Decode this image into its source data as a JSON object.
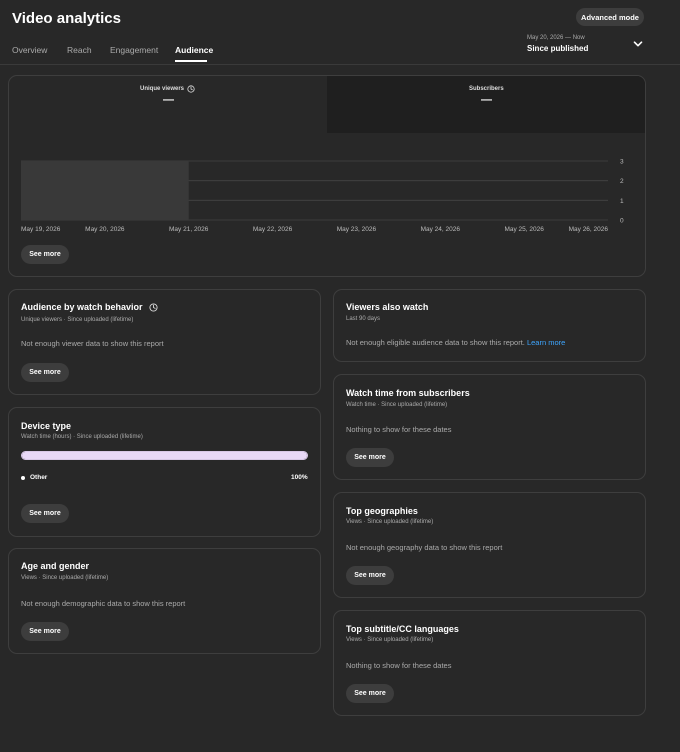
{
  "header": {
    "title": "Video analytics",
    "advanced_mode": "Advanced mode",
    "tabs": [
      "Overview",
      "Reach",
      "Engagement",
      "Audience"
    ],
    "active_tab": "Audience",
    "date_range": "May 20, 2026 — Now",
    "date_label": "Since published"
  },
  "metrics": {
    "unique_viewers_label": "Unique viewers",
    "unique_viewers_value": "—",
    "subscribers_label": "Subscribers",
    "subscribers_value": "—"
  },
  "chart_data": {
    "type": "line",
    "x": [
      "May 19, 2026",
      "May 20, 2026",
      "May 21, 2026",
      "May 22, 2026",
      "May 23, 2026",
      "May 24, 2026",
      "May 25, 2026",
      "May 26, 2026"
    ],
    "series": [],
    "ylim": [
      0,
      3
    ],
    "yticks": [
      "0",
      "1",
      "2",
      "3"
    ],
    "highlight_range": [
      "May 19, 2026",
      "May 21, 2026"
    ],
    "grid": true
  },
  "main_see_more": "See more",
  "cards": {
    "watch_behavior": {
      "title": "Audience by watch behavior",
      "subtitle": "Unique viewers · Since uploaded (lifetime)",
      "message": "Not enough viewer data to show this report",
      "button": "See more"
    },
    "device_type": {
      "title": "Device type",
      "subtitle": "Watch time (hours) · Since uploaded (lifetime)",
      "legend_label": "Other",
      "legend_value": "100%",
      "progress": 100,
      "button": "See more"
    },
    "age_gender": {
      "title": "Age and gender",
      "subtitle": "Views · Since uploaded (lifetime)",
      "message": "Not enough demographic data to show this report",
      "button": "See more"
    },
    "viewers_also_watch": {
      "title": "Viewers also watch",
      "subtitle": "Last 90 days",
      "message": "Not enough eligible audience data to show this report.",
      "link": "Learn more"
    },
    "watch_time_subscribers": {
      "title": "Watch time from subscribers",
      "subtitle": "Watch time · Since uploaded (lifetime)",
      "message": "Nothing to show for these dates",
      "button": "See more"
    },
    "top_geographies": {
      "title": "Top geographies",
      "subtitle": "Views · Since uploaded (lifetime)",
      "message": "Not enough geography data to show this report",
      "button": "See more"
    },
    "top_subtitle": {
      "title": "Top subtitle/CC languages",
      "subtitle": "Views · Since uploaded (lifetime)",
      "message": "Nothing to show for these dates",
      "button": "See more"
    }
  }
}
